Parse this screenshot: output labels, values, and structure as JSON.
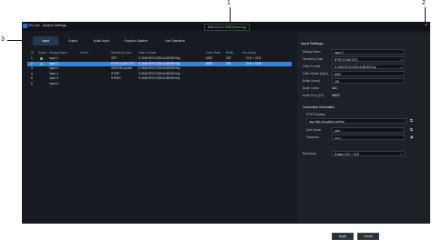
{
  "app": {
    "title": "NX Live - System Settings",
    "status_text": "XXX.X.X.X / XXX ",
    "status_ok": "(Running)",
    "close": "×"
  },
  "tabs": [
    {
      "label": "Input"
    },
    {
      "label": "Output"
    },
    {
      "label": "Audio Input"
    },
    {
      "label": "Graphics System"
    },
    {
      "label": "Live Operation"
    }
  ],
  "grid": {
    "headers": [
      "ID",
      "Status",
      "Display Name",
      "Name",
      "Streaming Type",
      "Video Format",
      "Video Rate",
      "Buffer",
      "Recording"
    ],
    "rows": [
      {
        "id": "1",
        "name": "Input 1",
        "stype": "SRT",
        "vfmt": "H.264/HEVC/1920x1080/59.94p",
        "vrate": "6000",
        "buffer": "200",
        "rec": "CH1 + CH2",
        "dot": "#4bd37b",
        "sel": false
      },
      {
        "id": "2",
        "name": "Input 2",
        "stype": "RTSP (CDN/TCP)",
        "vfmt": "H.264/HEVC/1920x1080/59.94p",
        "vrate": "6000",
        "buffer": "200",
        "rec": "CH1 + CH2",
        "dot": "#4bd37b",
        "sel": true
      },
      {
        "id": "3",
        "name": "Input 3",
        "stype": "SDK/HW packet",
        "vfmt": "H.264/HEVC/1920x1080/59.94p",
        "vrate": "",
        "buffer": "",
        "rec": "",
        "dot": "",
        "sel": false
      },
      {
        "id": "4",
        "name": "Input 4",
        "stype": "RTMP",
        "vfmt": "H.264/HEVC/1920x1080/59.94p",
        "vrate": "",
        "buffer": "",
        "rec": "",
        "dot": "",
        "sel": false
      },
      {
        "id": "5",
        "name": "Input 5",
        "stype": "NTR/IS",
        "vfmt": "H.264/HEVC/1920x1080/59.94p",
        "vrate": "",
        "buffer": "",
        "rec": "",
        "dot": "",
        "sel": false
      },
      {
        "id": "6",
        "name": "Input 6",
        "stype": "",
        "vfmt": "",
        "vrate": "",
        "buffer": "",
        "rec": "",
        "dot": "",
        "sel": false
      }
    ]
  },
  "panel": {
    "title": "Input Settings",
    "fields": [
      {
        "label": "Display Name",
        "value": "Input 2",
        "dropdown": false
      },
      {
        "label": "Streaming Type",
        "value": "RTSP (CDN/TCP)",
        "dropdown": true
      },
      {
        "label": "Video Format",
        "value": "H.264/HEVC/1920x1080/59.94p",
        "dropdown": true
      },
      {
        "label": "Video Bitrate (kbps)",
        "value": "6000",
        "dropdown": false
      },
      {
        "label": "Buffer (msec)",
        "value": "200",
        "dropdown": false
      }
    ],
    "audio_codec_label": "Audio Codec",
    "audio_codec_value": "AAC",
    "audio_freq_label": "Audio Freq. (Hz)",
    "audio_freq_value": "48000",
    "conn_title": "Connection Information",
    "rtsp_label": "RTSP Address",
    "rtsp_value": "rtsp://lab-liveuplink.com/live",
    "user_label": "User Name",
    "user_value": "user",
    "pass_label": "Password",
    "pass_value": "••••••",
    "rec_label": "Recording",
    "rec_value": "Enable CH1 + CH2",
    "apply": "Apply",
    "cancel": "Cancel"
  },
  "callouts": [
    "1",
    "2",
    "3"
  ]
}
